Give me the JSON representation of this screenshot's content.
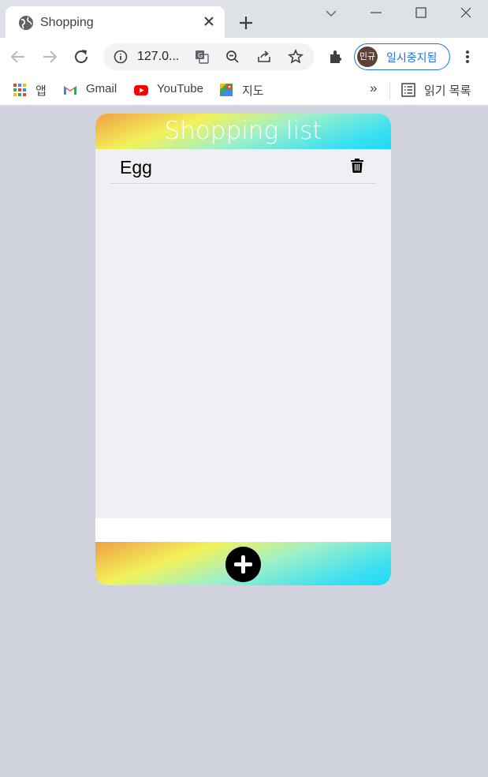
{
  "browser": {
    "tab": {
      "title": "Shopping",
      "favicon": "globe-icon"
    },
    "address_bar": {
      "url_display": "127.0..."
    },
    "profile": {
      "avatar_text": "민규",
      "status_label": "일시중지됨"
    },
    "bookmarks": [
      {
        "label": "앱",
        "icon": "apps-grid-icon"
      },
      {
        "label": "Gmail",
        "icon": "gmail-icon"
      },
      {
        "label": "YouTube",
        "icon": "youtube-icon"
      },
      {
        "label": "지도",
        "icon": "maps-icon"
      }
    ],
    "bookmarks_overflow": "»",
    "reading_list_label": "읽기 목록",
    "colors": {
      "tabstrip": "#dee1e6",
      "accent": "#1a73e8"
    }
  },
  "app": {
    "title": "Shopping list",
    "items": [
      {
        "name": "Egg"
      }
    ],
    "colors": {
      "background": "#d0d3de",
      "list_background": "#efeff4",
      "gradient": [
        "#f0a044",
        "#f2f25a",
        "#9ff0c8",
        "#1fd8f5"
      ]
    }
  }
}
